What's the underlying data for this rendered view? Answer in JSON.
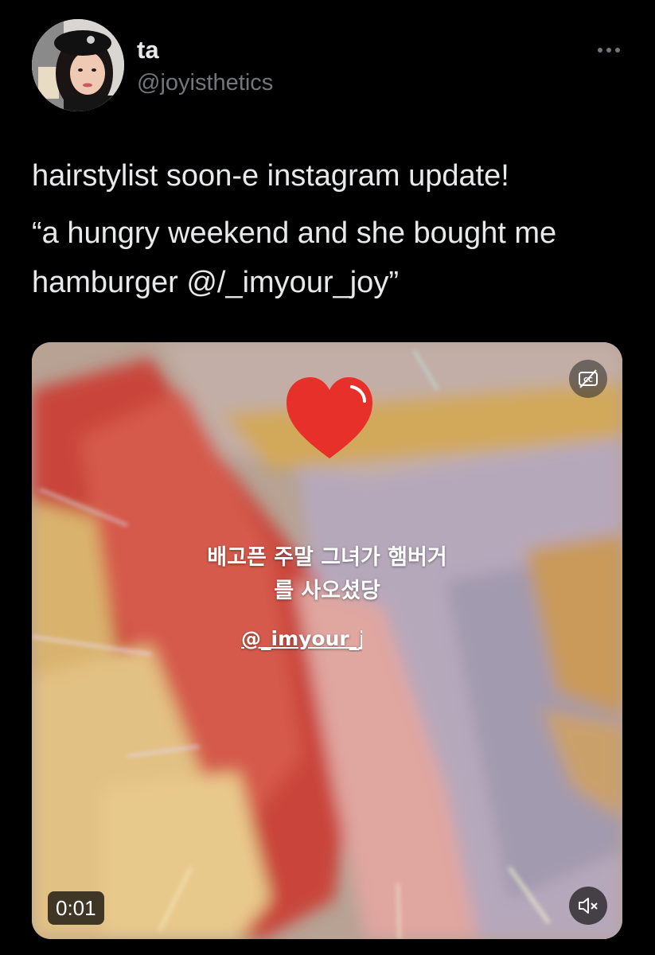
{
  "tweet": {
    "author": {
      "display_name": "ta",
      "handle": "@joyisthetics"
    },
    "more_icon": "more-horizontal-icon",
    "text_lines": [
      "hairstylist soon-e instagram update!",
      "“a hungry weekend and she bought me hamburger @/_imyour_joy”"
    ],
    "media": {
      "overlay_caption_line1": "배고픈 주말 그녀가 햄버거",
      "overlay_caption_line2": "를 사오셨당",
      "overlay_mention": "@_imyour_joy",
      "timestamp": "0:01",
      "cc_icon": "closed-captions-off-icon",
      "mute_icon": "speaker-muted-icon",
      "sticker": "red-heart-sticker"
    }
  },
  "colors": {
    "background": "#000000",
    "primary_text": "#e7e9ea",
    "secondary_text": "#71767b",
    "heart": "#e8302a"
  }
}
